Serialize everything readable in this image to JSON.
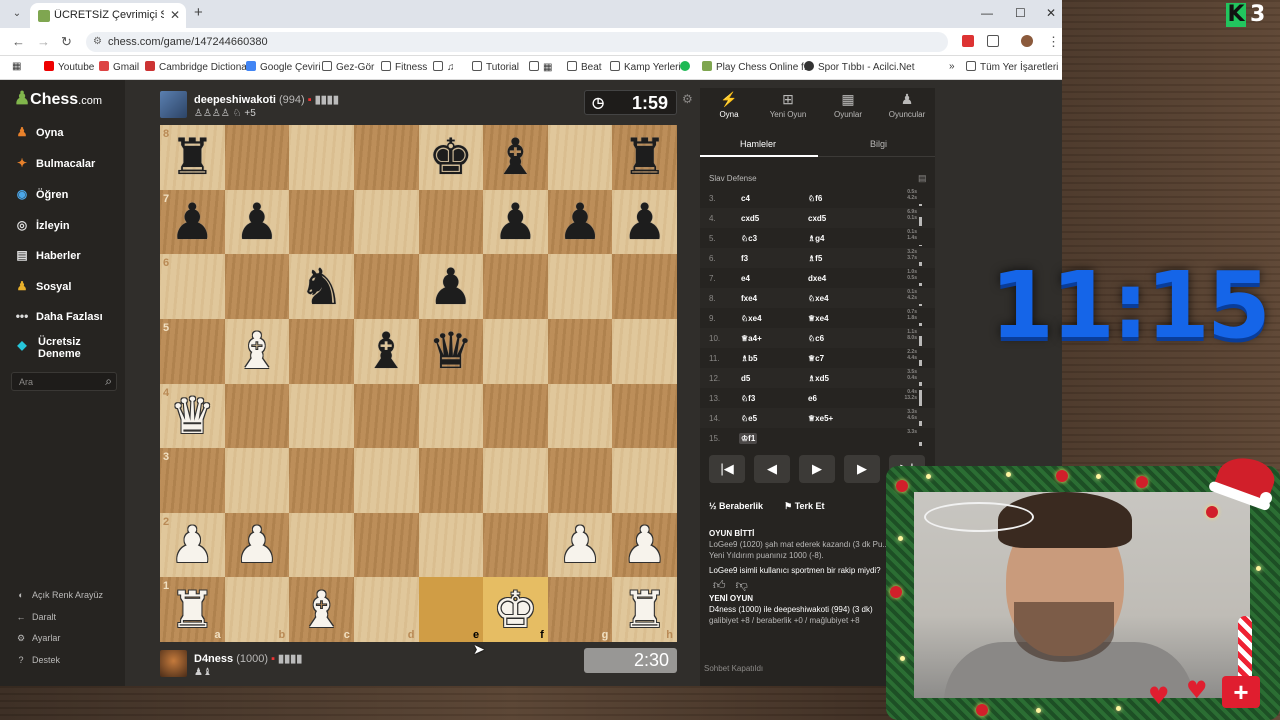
{
  "browser": {
    "tab_title": "ÜCRETSİZ Çevrimiçi Satranç Oyna",
    "url": "chess.com/game/147244660380",
    "bookmarks": [
      "Youtube",
      "Gmail",
      "Cambridge Dictiona...",
      "Google Çeviri",
      "Gez-Gör",
      "Fitness",
      "Tutorial",
      "Beat",
      "Kamp Yerleri",
      "Play Chess Online f...",
      "Spor Tıbbı - Acilci.Net",
      "Tüm Yer İşaretleri"
    ],
    "more": "»"
  },
  "sidebar": {
    "logo": "Chess",
    "logo_suffix": ".com",
    "items": [
      {
        "label": "Oyna",
        "icon": "play-icon"
      },
      {
        "label": "Bulmacalar",
        "icon": "puzzle-icon"
      },
      {
        "label": "Öğren",
        "icon": "learn-icon"
      },
      {
        "label": "İzleyin",
        "icon": "watch-icon"
      },
      {
        "label": "Haberler",
        "icon": "news-icon"
      },
      {
        "label": "Sosyal",
        "icon": "social-icon"
      },
      {
        "label": "Daha Fazlası",
        "icon": "more-icon"
      },
      {
        "label": "Ücretsiz Deneme",
        "icon": "diamond-icon"
      }
    ],
    "search_placeholder": "Ara",
    "footer": [
      "Açık Renk Arayüz",
      "Daralt",
      "Ayarlar",
      "Destek"
    ]
  },
  "top_player": {
    "name": "deepeshiwakoti",
    "rating": "(994)",
    "captured": "+5",
    "clock": "1:59"
  },
  "bottom_player": {
    "name": "D4ness",
    "rating": "(1000)",
    "clock": "2:30"
  },
  "board": {
    "ranks": [
      "8",
      "7",
      "6",
      "5",
      "4",
      "3",
      "2",
      "1"
    ],
    "files": [
      "a",
      "b",
      "c",
      "d",
      "e",
      "f",
      "g",
      "h"
    ],
    "highlight": [
      "e1",
      "f1"
    ],
    "position": [
      [
        "bR",
        "",
        "",
        "",
        "bK",
        "bB",
        "",
        "bR"
      ],
      [
        "bP",
        "bP",
        "",
        "",
        "",
        "bP",
        "bP",
        "bP"
      ],
      [
        "",
        "",
        "bN",
        "",
        "bP",
        "",
        "",
        ""
      ],
      [
        "",
        "wB",
        "",
        "bB",
        "bQ",
        "",
        "",
        ""
      ],
      [
        "wQ",
        "",
        "",
        "",
        "",
        "",
        "",
        ""
      ],
      [
        "",
        "",
        "",
        "",
        "",
        "",
        "",
        ""
      ],
      [
        "wP",
        "wP",
        "",
        "",
        "",
        "",
        "wP",
        "wP"
      ],
      [
        "wR",
        "",
        "wB",
        "",
        "",
        "wK",
        "",
        "wR"
      ]
    ]
  },
  "panel": {
    "tabs": [
      {
        "label": "Oyna",
        "icon": "bolt-icon"
      },
      {
        "label": "Yeni Oyun",
        "icon": "plus-icon"
      },
      {
        "label": "Oyunlar",
        "icon": "board-icon"
      },
      {
        "label": "Oyuncular",
        "icon": "players-icon"
      }
    ],
    "subtabs": [
      "Hamleler",
      "Bilgi"
    ],
    "opening": "Slav Defense",
    "moves": [
      {
        "n": "3.",
        "w": "c4",
        "b": "♘f6",
        "t": "0.5s\n4.2s"
      },
      {
        "n": "4.",
        "w": "cxd5",
        "b": "cxd5",
        "t": "6.9s\n0.1s"
      },
      {
        "n": "5.",
        "w": "♘c3",
        "b": "♗g4",
        "t": "0.1s\n1.4s"
      },
      {
        "n": "6.",
        "w": "f3",
        "b": "♗f5",
        "t": "3.2s\n3.7s"
      },
      {
        "n": "7.",
        "w": "e4",
        "b": "dxe4",
        "t": "1.0s\n0.5s"
      },
      {
        "n": "8.",
        "w": "fxe4",
        "b": "♘xe4",
        "t": "0.1s\n4.2s"
      },
      {
        "n": "9.",
        "w": "♘xe4",
        "b": "♕xe4",
        "t": "0.7s\n1.8s"
      },
      {
        "n": "10.",
        "w": "♕a4+",
        "b": "♘c6",
        "t": "1.1s\n8.0s"
      },
      {
        "n": "11.",
        "w": "♗b5",
        "b": "♕c7",
        "t": "2.2s\n4.4s"
      },
      {
        "n": "12.",
        "w": "d5",
        "b": "♗xd5",
        "t": "3.5s\n0.4s"
      },
      {
        "n": "13.",
        "w": "♘f3",
        "b": "e6",
        "t": "0.4s\n13.2s"
      },
      {
        "n": "14.",
        "w": "♘e5",
        "b": "♕xe5+",
        "t": "3.3s\n4.6s"
      },
      {
        "n": "15.",
        "w": "♔f1",
        "b": "",
        "t": "3.3s"
      }
    ],
    "time_bars": [
      0.1,
      0.55,
      0.08,
      0.26,
      0.18,
      0.12,
      0.16,
      0.65,
      0.38,
      0.22,
      1.0,
      0.32,
      0.26
    ],
    "controls": [
      "|◀",
      "◀",
      "▶",
      "▶",
      "▶|"
    ],
    "draw_label": "Beraberlik",
    "resign_label": "Terk Et",
    "chat": [
      {
        "kind": "b",
        "text": "OYUN BİTTİ"
      },
      {
        "kind": "t",
        "text": "LoGee9 (1020) şah mat ederek kazandı (3 dk Pu..."
      },
      {
        "kind": "t",
        "text": "Yeni Yıldırım puanınız 1000 (-8)."
      },
      {
        "kind": "w",
        "text": "LoGee9 isimli kullanıcı sportmen bir rakip miydi?"
      },
      {
        "kind": "b",
        "text": "YENİ OYUN"
      },
      {
        "kind": "w",
        "text": "D4ness (1000) ile deepeshiwakoti (994) (3 dk)"
      },
      {
        "kind": "t",
        "text": "galibiyet +8 / beraberlik +0 / mağlubiyet +8"
      }
    ],
    "chat_closed": "Sohbet Kapatıldı"
  },
  "overlay": {
    "badge_letter": "K",
    "badge_number": "3",
    "stream_time": "11:15"
  }
}
